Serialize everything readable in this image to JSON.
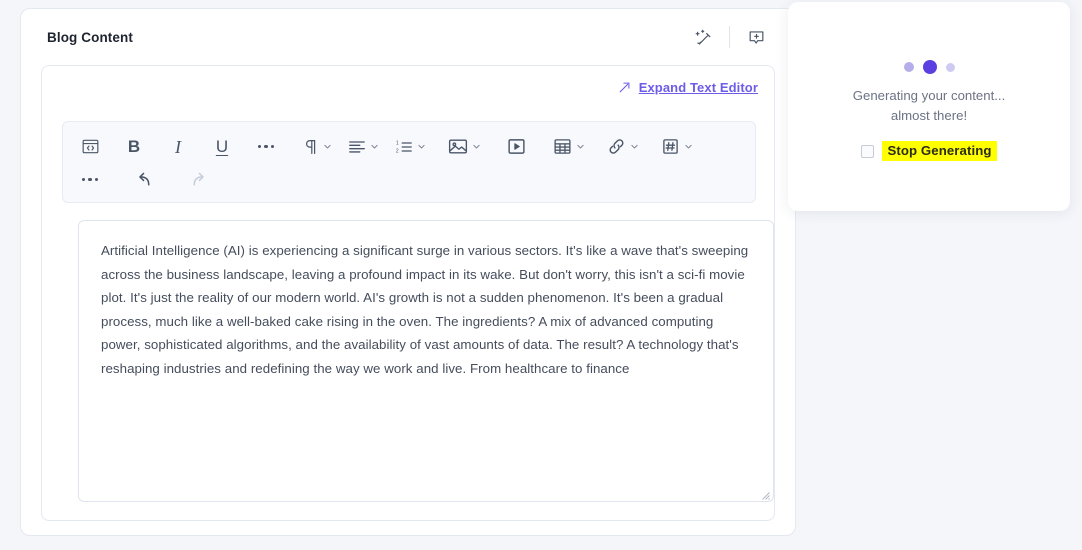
{
  "card": {
    "title": "Blog Content",
    "header_icons": [
      {
        "name": "magic-wand-icon",
        "label": "AI assist"
      },
      {
        "name": "add-comment-icon",
        "label": "Add comment"
      }
    ]
  },
  "editor": {
    "expand_link": "Expand Text Editor",
    "expand_icon": "expand-arrow-icon",
    "toolbar": {
      "row1": [
        {
          "name": "code-block-icon",
          "glyph": "code",
          "caret": false
        },
        {
          "name": "bold-icon",
          "glyph": "B",
          "caret": false
        },
        {
          "name": "italic-icon",
          "glyph": "I",
          "caret": false
        },
        {
          "name": "underline-icon",
          "glyph": "U",
          "caret": false
        },
        {
          "name": "more-formats-icon",
          "glyph": "dots",
          "caret": false
        },
        {
          "name": "paragraph-style-icon",
          "glyph": "pilcrow",
          "caret": true
        },
        {
          "name": "align-icon",
          "glyph": "align",
          "caret": true
        },
        {
          "name": "numbered-list-icon",
          "glyph": "numlist",
          "caret": true
        },
        {
          "name": "image-icon",
          "glyph": "image",
          "caret": true
        },
        {
          "name": "video-icon",
          "glyph": "video",
          "caret": false
        },
        {
          "name": "table-icon",
          "glyph": "table",
          "caret": true
        },
        {
          "name": "link-icon",
          "glyph": "link",
          "caret": true
        },
        {
          "name": "hashtag-icon",
          "glyph": "hashtag",
          "caret": true
        }
      ],
      "row2": [
        {
          "name": "more-tools-icon",
          "glyph": "dots",
          "caret": false
        },
        {
          "name": "undo-icon",
          "glyph": "undo",
          "caret": false
        },
        {
          "name": "redo-icon",
          "glyph": "redo",
          "caret": false,
          "disabled": true
        }
      ]
    },
    "content": "Artificial Intelligence (AI) is experiencing a significant surge in various sectors. It's like a wave that's sweeping across the business landscape, leaving a profound impact in its wake. But don't worry, this isn't a sci-fi movie plot. It's just the reality of our modern world. AI's growth is not a sudden phenomenon. It's been a gradual process, much like a well-baked cake rising in the oven. The ingredients? A mix of advanced computing power, sophisticated algorithms, and the availability of vast amounts of data. The result? A technology that's reshaping industries and redefining the way we work and live. From healthcare to finance"
  },
  "popup": {
    "status_line_1": "Generating your content...",
    "status_line_2": "almost there!",
    "stop_label": "Stop Generating",
    "dot_colors": [
      "#b6aeea",
      "#5b3fe0",
      "#cfcaf1"
    ],
    "highlight_color": "#ffff00"
  },
  "colors": {
    "page_background": "#f4f6fa",
    "card_background": "#ffffff",
    "accent": "#6c5ce7",
    "toolbar_background": "#f7f9fc",
    "text": "#454d5c"
  }
}
